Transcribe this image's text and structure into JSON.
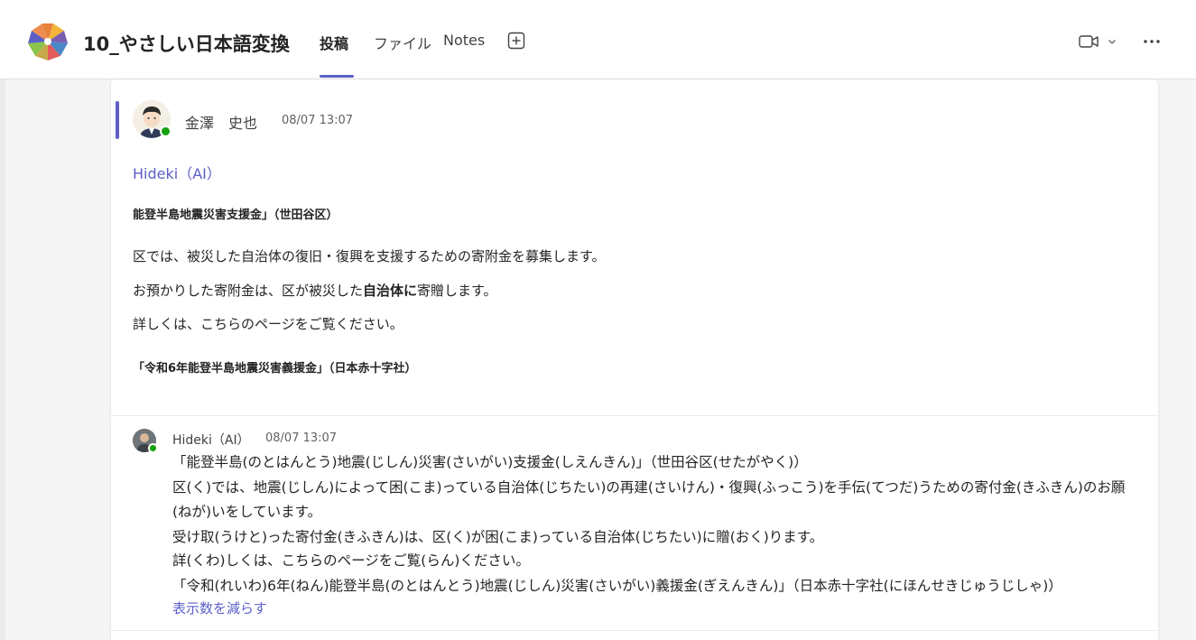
{
  "header": {
    "team_title": "10_やさしい日本語変換",
    "tabs": [
      {
        "label": "投稿",
        "active": true
      },
      {
        "label": "ファイル",
        "active": false
      },
      {
        "label": "Notes",
        "active": false
      }
    ],
    "icons": {
      "add_tab": "plus-square-icon",
      "video": "video-camera-icon",
      "chevron": "chevron-down-icon",
      "more": "more-horizontal-icon"
    }
  },
  "post": {
    "author": "金澤　史也",
    "timestamp": "08/07 13:07",
    "subject": "Hideki（AI）",
    "title_line": "能登半島地震災害支援金」（世田谷区）",
    "body": {
      "line1": "区では、被災した自治体の復旧・復興を支援するための寄附金を募集します。",
      "line2_pre": "お預かりした寄附金は、区が被災した",
      "line2_bold": "自治体に",
      "line2_post": "寄贈します。",
      "line3": "詳しくは、こちらのページをご覧ください。"
    },
    "footer_line": "「令和6年能登半島地震災害義援金」（日本赤十字社）"
  },
  "reply": {
    "author": "Hideki（AI）",
    "timestamp": "08/07 13:07",
    "lines": [
      "「能登半島(のとはんとう)地震(じしん)災害(さいがい)支援金(しえんきん)」（世田谷区(せたがやく)）",
      "区(く)では、地震(じしん)によって困(こま)っている自治体(じちたい)の再建(さいけん)・復興(ふっこう)を手伝(てつだ)うための寄付金(きふきん)のお願",
      "(ねが)いをしています。",
      "受け取(うけと)った寄付金(きふきん)は、区(く)が困(こま)っている自治体(じちたい)に贈(おく)ります。",
      "詳(くわ)しくは、こちらのページをご覧(らん)ください。",
      "「令和(れいわ)6年(ねん)能登半島(のとはんとう)地震(じしん)災害(さいがい)義援金(ぎえんきん)」（日本赤十字社(にほんせきじゅうじしゃ)）"
    ],
    "collapse_label": "表示数を減らす"
  },
  "colors": {
    "accent": "#5b5fc7",
    "presence": "#13a10e"
  }
}
